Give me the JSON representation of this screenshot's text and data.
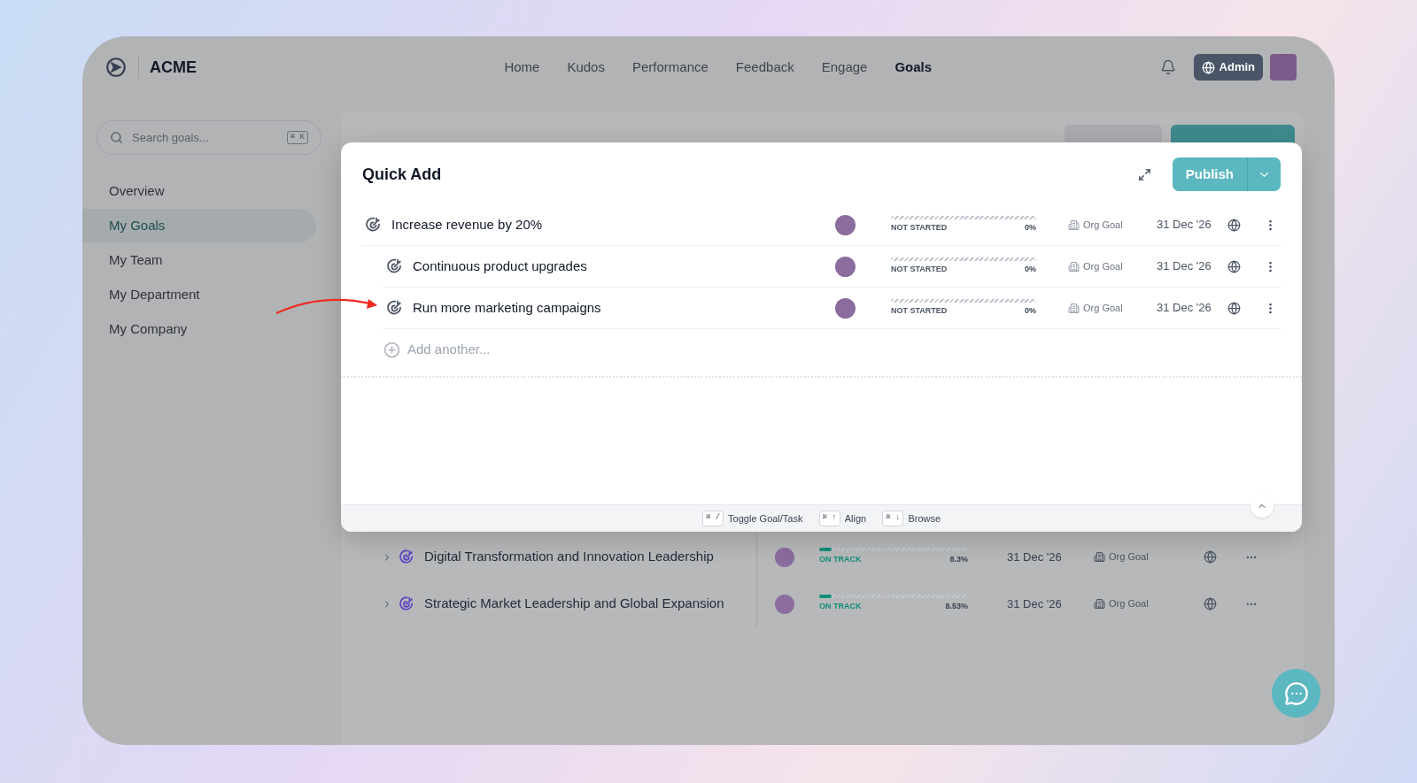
{
  "brand": {
    "name": "ACME"
  },
  "nav": [
    {
      "label": "Home",
      "selected": false
    },
    {
      "label": "Kudos",
      "selected": false
    },
    {
      "label": "Performance",
      "selected": false
    },
    {
      "label": "Feedback",
      "selected": false
    },
    {
      "label": "Engage",
      "selected": false
    },
    {
      "label": "Goals",
      "selected": true
    }
  ],
  "account": {
    "role_button": "Admin"
  },
  "search": {
    "placeholder": "Search goals...",
    "shortcut": "⌘ K"
  },
  "sidebar": {
    "items": [
      {
        "label": "Overview",
        "selected": false
      },
      {
        "label": "My Goals",
        "selected": true
      },
      {
        "label": "My Team",
        "selected": false
      },
      {
        "label": "My Department",
        "selected": false
      },
      {
        "label": "My Company",
        "selected": false
      }
    ]
  },
  "background_goals": [
    {
      "title": "Digital Transformation and Innovation Leadership",
      "kind": "on_track",
      "status": "ON TRACK",
      "level": 0.083,
      "progress": "8.3%",
      "date": "31 Dec '26",
      "type": "Org Goal"
    },
    {
      "title": "Strategic Market Leadership and Global Expansion",
      "kind": "on_track",
      "status": "ON TRACK",
      "level": 0.0853,
      "progress": "8.53%",
      "date": "31 Dec '26",
      "type": "Org Goal"
    }
  ],
  "quick_add": {
    "title": "Quick Add",
    "publish_button": "Publish",
    "goals": [
      {
        "title": "Increase revenue by 20%",
        "kind": "not_started",
        "status": "NOT STARTED",
        "progress": "0%",
        "type": "Org Goal",
        "date": "31 Dec '26",
        "children": [
          {
            "title": "Continuous product upgrades",
            "kind": "not_started",
            "status": "NOT STARTED",
            "progress": "0%",
            "type": "Org Goal",
            "date": "31 Dec '26"
          },
          {
            "title": "Run more marketing campaigns",
            "kind": "not_started",
            "status": "NOT STARTED",
            "progress": "0%",
            "type": "Org Goal",
            "date": "31 Dec '26"
          }
        ]
      }
    ],
    "add_placeholder": "Add another...",
    "shortcuts": [
      {
        "keys": "⌘ /",
        "label": "Toggle Goal/Task"
      },
      {
        "keys": "⌘ ↑",
        "label": "Align"
      },
      {
        "keys": "⌘ ↓",
        "label": "Browse"
      }
    ]
  }
}
